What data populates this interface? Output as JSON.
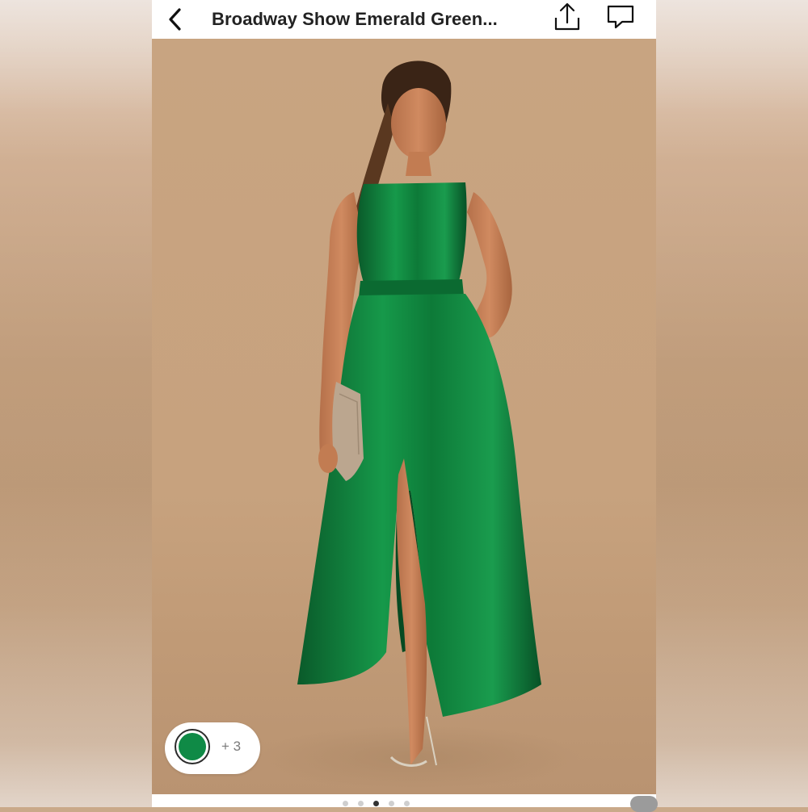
{
  "header": {
    "title": "Broadway Show Emerald Green...",
    "back_icon": "chevron-left-icon",
    "share_icon": "share-upload-icon",
    "comment_icon": "comment-bubble-icon"
  },
  "listing": {
    "image_subject": "woman-in-emerald-green-satin-high-low-dress",
    "colors": {
      "dress": "#0f7a3a",
      "background": "#c7a27e",
      "swatch": "#0f8a46"
    }
  },
  "variants": {
    "selected_color": "#0f8a46",
    "more_label": "+ 3"
  },
  "carousel": {
    "total_dots": 5,
    "active_index": 2
  }
}
